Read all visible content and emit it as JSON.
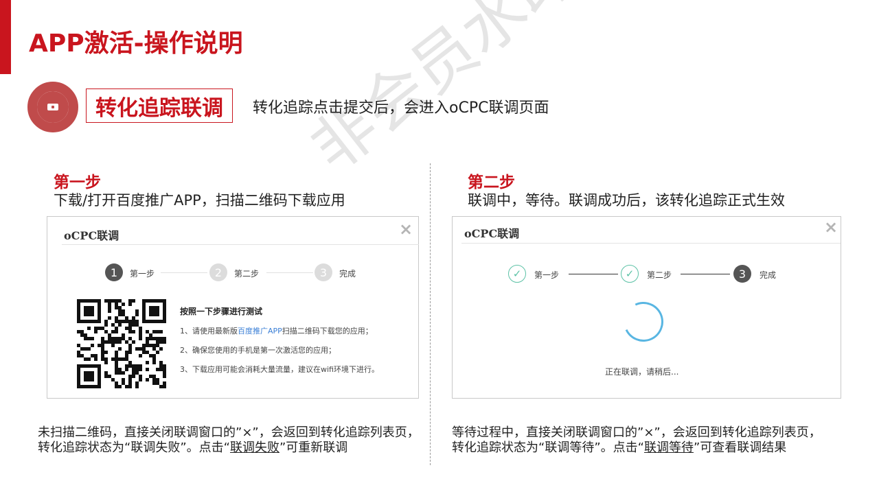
{
  "page": {
    "title": "APP激活-操作说明",
    "watermark": "非会员水印",
    "section_label": "转化追踪联调",
    "section_desc": "转化追踪点击提交后，会进入oCPC联调页面"
  },
  "left": {
    "step_title": "第一步",
    "step_desc": "下载/打开百度推广APP，扫描二维码下载应用",
    "panel": {
      "title": "oCPC联调",
      "close": "×",
      "steps": [
        {
          "num": "1",
          "label": "第一步"
        },
        {
          "num": "2",
          "label": "第二步"
        },
        {
          "num": "3",
          "label": "完成"
        }
      ],
      "instructions_title": "按照一下步骤进行测试",
      "instr1_pre": "1、请使用最新版",
      "instr1_link": "百度推广APP",
      "instr1_post": "扫描二维码下载您的应用；",
      "instr2": "2、确保您使用的手机是第一次激活您的应用；",
      "instr3": "3、下载应用可能会消耗大量流量，建议在wifi环境下进行。"
    },
    "note_line1": "未扫描二维码，直接关闭联调窗口的”×”，会返回到转化追踪列表页，",
    "note_line2_pre": "转化追踪状态为“联调失败”。点击“",
    "note_link": "联调失败",
    "note_line2_post": "”可重新联调"
  },
  "right": {
    "step_title": "第二步",
    "step_desc": "联调中，等待。联调成功后，该转化追踪正式生效",
    "panel": {
      "title": "oCPC联调",
      "close": "×",
      "steps": [
        {
          "num": "✓",
          "label": "第一步"
        },
        {
          "num": "✓",
          "label": "第二步"
        },
        {
          "num": "3",
          "label": "完成"
        }
      ],
      "loading_text": "正在联调，请稍后..."
    },
    "note_line1": "等待过程中，直接关闭联调窗口的”×”，会返回到转化追踪列表页，",
    "note_line2_pre": "转化追踪状态为“联调等待”。点击“",
    "note_link": "联调等待",
    "note_line2_post": "”可查看联调结果"
  },
  "colors": {
    "accent": "#c9151e",
    "check": "#5cc2a6",
    "spinner": "#59b6e2",
    "link": "#3b7fd6"
  }
}
